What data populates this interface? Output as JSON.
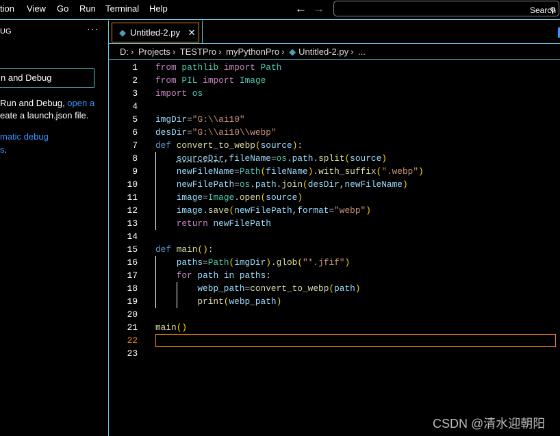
{
  "menu": [
    "tion",
    "View",
    "Go",
    "Run",
    "Terminal",
    "Help"
  ],
  "search": {
    "label": "Search"
  },
  "sidebar": {
    "title": "UG",
    "more": "···",
    "button": "n and Debug",
    "text1a": "Run and Debug, ",
    "text1b": "open a",
    "text2": "eate a launch.json file.",
    "link2": "matic debug",
    "link3": "s",
    "dot": "."
  },
  "tab": {
    "label": "Untitled-2.py",
    "close": "✕"
  },
  "breadcrumb": [
    "D:",
    "Projects",
    "TESTPro",
    "myPythonPro",
    "Untitled-2.py",
    "..."
  ],
  "editor": {
    "current_line": 22,
    "lines": [
      {
        "n": 1,
        "i": 0,
        "t": [
          [
            "from",
            "k"
          ],
          [
            " "
          ],
          [
            "pathlib",
            "m"
          ],
          [
            " "
          ],
          [
            "import",
            "k"
          ],
          [
            " "
          ],
          [
            "Path",
            "m"
          ]
        ]
      },
      {
        "n": 2,
        "i": 0,
        "t": [
          [
            "from",
            "k"
          ],
          [
            " "
          ],
          [
            "PIL",
            "m"
          ],
          [
            " "
          ],
          [
            "import",
            "k"
          ],
          [
            " "
          ],
          [
            "Image",
            "m"
          ]
        ]
      },
      {
        "n": 3,
        "i": 0,
        "t": [
          [
            "import",
            "k"
          ],
          [
            " "
          ],
          [
            "os",
            "m"
          ]
        ]
      },
      {
        "n": 4,
        "i": 0,
        "t": []
      },
      {
        "n": 5,
        "i": 0,
        "t": [
          [
            "imgDir",
            "v"
          ],
          [
            "=",
            "p"
          ],
          [
            "\"G:\\\\ai10\"",
            "s"
          ]
        ]
      },
      {
        "n": 6,
        "i": 0,
        "t": [
          [
            "desDir",
            "v"
          ],
          [
            "=",
            "p"
          ],
          [
            "\"G:\\\\ai10\\\\webp\"",
            "s"
          ]
        ]
      },
      {
        "n": 7,
        "i": 0,
        "t": [
          [
            "def",
            "d"
          ],
          [
            " "
          ],
          [
            "convert_to_webp",
            "f"
          ],
          [
            "(",
            "b"
          ],
          [
            "source",
            "v"
          ],
          [
            ")",
            "b"
          ],
          [
            ":",
            "p"
          ]
        ]
      },
      {
        "n": 8,
        "i": 1,
        "t": [
          [
            "sourceDir",
            "v u"
          ],
          [
            ",",
            "p"
          ],
          [
            "fileName",
            "v"
          ],
          [
            "=",
            "p"
          ],
          [
            "os",
            "m"
          ],
          [
            ".",
            "p"
          ],
          [
            "path",
            "v"
          ],
          [
            ".",
            "p"
          ],
          [
            "split",
            "f"
          ],
          [
            "(",
            "b"
          ],
          [
            "source",
            "v"
          ],
          [
            ")",
            "b"
          ]
        ]
      },
      {
        "n": 9,
        "i": 1,
        "t": [
          [
            "newFileName",
            "v"
          ],
          [
            "=",
            "p"
          ],
          [
            "Path",
            "m"
          ],
          [
            "(",
            "b"
          ],
          [
            "fileName",
            "v"
          ],
          [
            ")",
            "b"
          ],
          [
            ".",
            "p"
          ],
          [
            "with_suffix",
            "f"
          ],
          [
            "(",
            "b"
          ],
          [
            "\".webp\"",
            "s"
          ],
          [
            ")",
            "b"
          ]
        ]
      },
      {
        "n": 10,
        "i": 1,
        "t": [
          [
            "newFilePath",
            "v"
          ],
          [
            "=",
            "p"
          ],
          [
            "os",
            "m"
          ],
          [
            ".",
            "p"
          ],
          [
            "path",
            "v"
          ],
          [
            ".",
            "p"
          ],
          [
            "join",
            "f"
          ],
          [
            "(",
            "b"
          ],
          [
            "desDir",
            "v"
          ],
          [
            ",",
            "p"
          ],
          [
            "newFileName",
            "v"
          ],
          [
            ")",
            "b"
          ]
        ]
      },
      {
        "n": 11,
        "i": 1,
        "t": [
          [
            "image",
            "v"
          ],
          [
            "=",
            "p"
          ],
          [
            "Image",
            "m"
          ],
          [
            ".",
            "p"
          ],
          [
            "open",
            "f"
          ],
          [
            "(",
            "b"
          ],
          [
            "source",
            "v"
          ],
          [
            ")",
            "b"
          ]
        ]
      },
      {
        "n": 12,
        "i": 1,
        "t": [
          [
            "image",
            "v"
          ],
          [
            ".",
            "p"
          ],
          [
            "save",
            "f"
          ],
          [
            "(",
            "b"
          ],
          [
            "newFilePath",
            "v"
          ],
          [
            ",",
            "p"
          ],
          [
            "format",
            "v"
          ],
          [
            "=",
            "p"
          ],
          [
            "\"webp\"",
            "s"
          ],
          [
            ")",
            "b"
          ]
        ]
      },
      {
        "n": 13,
        "i": 1,
        "t": [
          [
            "return",
            "k"
          ],
          [
            " "
          ],
          [
            "newFilePath",
            "v"
          ]
        ]
      },
      {
        "n": 14,
        "i": 0,
        "t": []
      },
      {
        "n": 15,
        "i": 0,
        "t": [
          [
            "def",
            "d"
          ],
          [
            " "
          ],
          [
            "main",
            "f"
          ],
          [
            "()",
            "b"
          ],
          [
            ":",
            "p"
          ]
        ]
      },
      {
        "n": 16,
        "i": 1,
        "t": [
          [
            "paths",
            "v"
          ],
          [
            "=",
            "p"
          ],
          [
            "Path",
            "m"
          ],
          [
            "(",
            "b"
          ],
          [
            "imgDir",
            "v"
          ],
          [
            ")",
            "b"
          ],
          [
            ".",
            "p"
          ],
          [
            "glob",
            "f"
          ],
          [
            "(",
            "b"
          ],
          [
            "\"*.jfif\"",
            "s"
          ],
          [
            ")",
            "b"
          ]
        ]
      },
      {
        "n": 17,
        "i": 1,
        "t": [
          [
            "for",
            "k"
          ],
          [
            " "
          ],
          [
            "path",
            "v"
          ],
          [
            " "
          ],
          [
            "in",
            "v"
          ],
          [
            " "
          ],
          [
            "paths",
            "v"
          ],
          [
            ":",
            "p"
          ]
        ]
      },
      {
        "n": 18,
        "i": 2,
        "t": [
          [
            "webp_path",
            "v"
          ],
          [
            "=",
            "p"
          ],
          [
            "convert_to_webp",
            "f"
          ],
          [
            "(",
            "b"
          ],
          [
            "path",
            "v"
          ],
          [
            ")",
            "b"
          ]
        ]
      },
      {
        "n": 19,
        "i": 2,
        "t": [
          [
            "print",
            "f"
          ],
          [
            "(",
            "b"
          ],
          [
            "webp_path",
            "v"
          ],
          [
            ")",
            "b"
          ]
        ]
      },
      {
        "n": 20,
        "i": 0,
        "t": []
      },
      {
        "n": 21,
        "i": 0,
        "t": [
          [
            "main",
            "f"
          ],
          [
            "()",
            "b"
          ]
        ]
      },
      {
        "n": 22,
        "i": 0,
        "t": []
      },
      {
        "n": 23,
        "i": 0,
        "t": []
      }
    ]
  },
  "watermark": "CSDN @清水迎朝阳"
}
